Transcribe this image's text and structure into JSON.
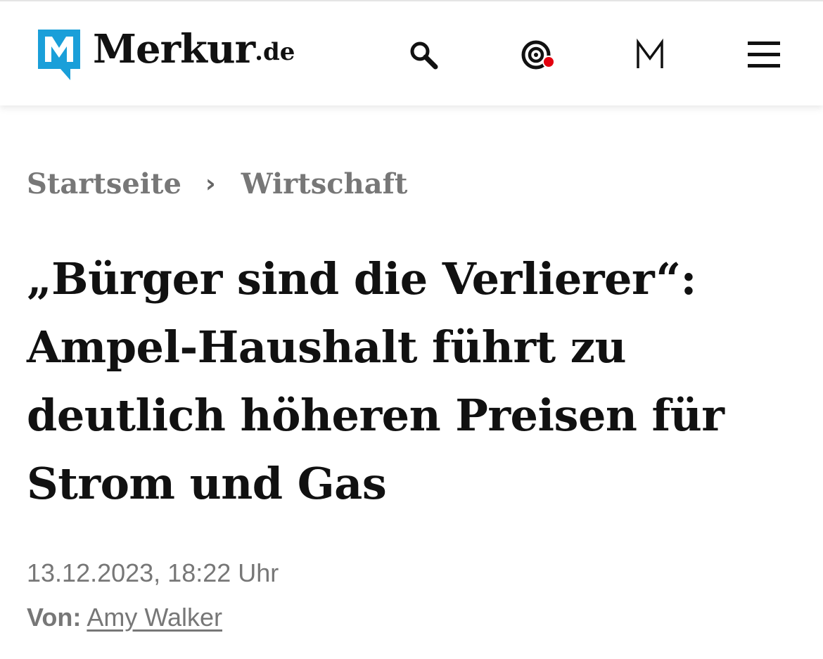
{
  "header": {
    "logo": {
      "mark_letter": "M",
      "name": "Merkur",
      "tld": ".de",
      "mark_color": "#1a9fd9"
    },
    "icons": [
      {
        "name": "search-icon"
      },
      {
        "name": "live-radio-icon",
        "badge_color": "#e3000f"
      },
      {
        "name": "m-account-icon"
      },
      {
        "name": "hamburger-menu-icon"
      }
    ]
  },
  "breadcrumb": {
    "items": [
      "Startseite",
      "Wirtschaft"
    ],
    "separator": "›"
  },
  "article": {
    "headline_lines": [
      "„Bürger sind die Verlierer“:",
      "Ampel-Haushalt führt zu",
      "deutlich höheren Preisen für",
      "Strom und Gas"
    ],
    "date": "13.12.2023, 18:22 Uhr",
    "author_label": "Von:",
    "author_name": "Amy Walker"
  }
}
